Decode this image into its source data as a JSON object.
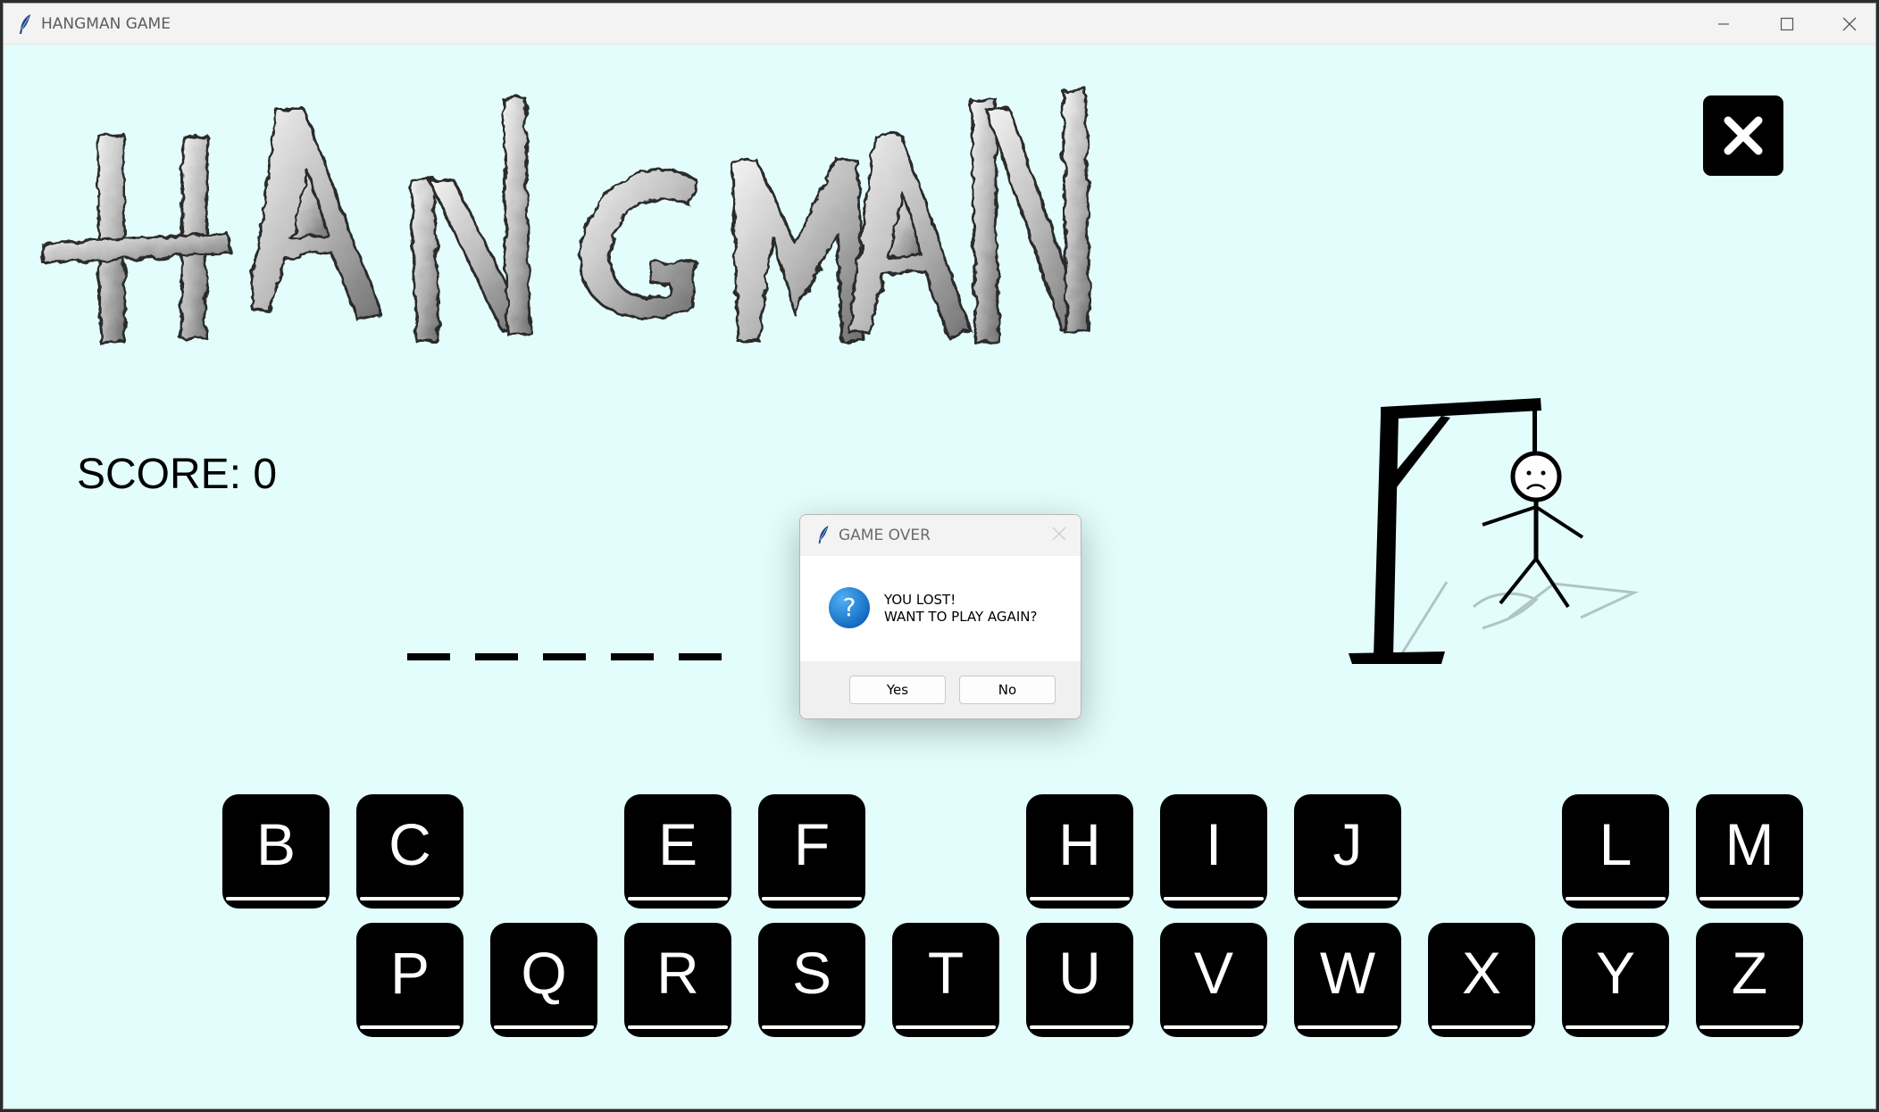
{
  "window": {
    "title": "HANGMAN GAME"
  },
  "game": {
    "logo_text": "HANGMAN",
    "score_text": "SCORE: 0",
    "word_blanks": 5,
    "keyboard_row1": [
      "B",
      "C",
      "E",
      "F",
      "H",
      "I",
      "J",
      "L",
      "M"
    ],
    "keyboard_row2": [
      "P",
      "Q",
      "R",
      "S",
      "T",
      "U",
      "V",
      "W",
      "X",
      "Y",
      "Z"
    ]
  },
  "dialog": {
    "title": "GAME OVER",
    "message_line1": "YOU LOST!",
    "message_line2": "WANT TO PLAY AGAIN?",
    "yes_label": "Yes",
    "no_label": "No"
  },
  "colors": {
    "background": "#e2fdfc",
    "key": "#000000",
    "dialog_icon": "#1d78d2"
  },
  "icons": {
    "app": "feather-icon",
    "close_game": "close-icon",
    "dialog": "question-icon"
  }
}
